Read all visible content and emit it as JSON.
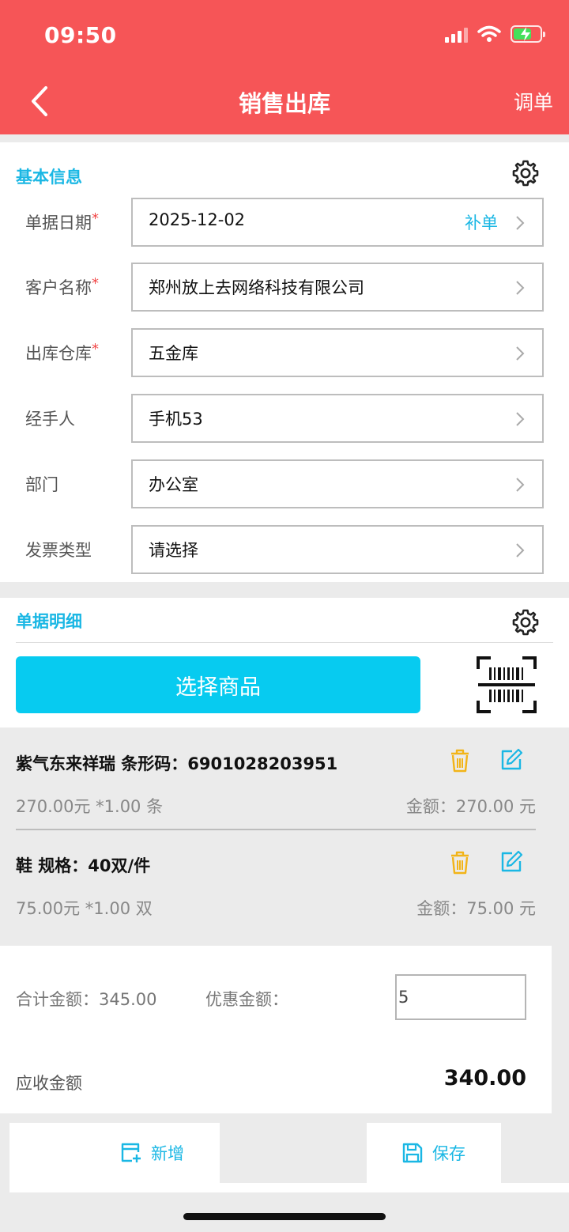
{
  "status_bar": {
    "time": "09:50"
  },
  "header": {
    "title": "销售出库",
    "right_action": "调单"
  },
  "basic_info": {
    "title": "基本信息",
    "fields": [
      {
        "label": "单据日期",
        "required": true,
        "value": "2025-12-02",
        "extra": "补单"
      },
      {
        "label": "客户名称",
        "required": true,
        "value": "郑州放上去网络科技有限公司"
      },
      {
        "label": "出库仓库",
        "required": true,
        "value": "五金库"
      },
      {
        "label": "经手人",
        "required": false,
        "value": "手机53"
      },
      {
        "label": "部门",
        "required": false,
        "value": "办公室"
      },
      {
        "label": "发票类型",
        "required": false,
        "value": "请选择"
      }
    ]
  },
  "detail": {
    "title": "单据明细",
    "select_button": "选择商品",
    "items": [
      {
        "title": "紫气东来祥瑞 条形码：6901028203951",
        "price_qty": "270.00元 *1.00 条",
        "amount": "金额：270.00 元"
      },
      {
        "title": "鞋 规格：40双/件",
        "price_qty": "75.00元 *1.00 双",
        "amount": "金额：75.00 元"
      }
    ]
  },
  "summary": {
    "total_label": "合计金额：",
    "total_value": "345.00",
    "discount_label": "优惠金额：",
    "discount_value": "5",
    "receivable_label": "应收金额",
    "receivable_value": "340.00"
  },
  "bottom_bar": {
    "add_label": "新增",
    "save_label": "保存"
  },
  "colors": {
    "header": "#f65557",
    "accent": "#1ab7e4",
    "button": "#07cbf0",
    "required": "#f24848",
    "trash": "#f2b418"
  }
}
